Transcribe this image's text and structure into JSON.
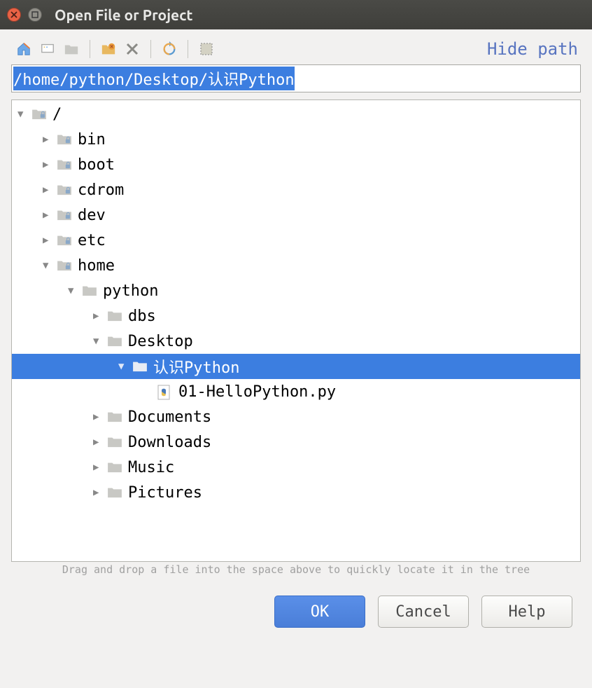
{
  "window": {
    "title": "Open File or Project"
  },
  "toolbar": {
    "hide_path": "Hide path"
  },
  "path_input": {
    "value": "/home/python/Desktop/认识Python"
  },
  "tree": [
    {
      "indent": 0,
      "expanded": true,
      "icon": "folder-lock",
      "label": "/"
    },
    {
      "indent": 1,
      "expanded": false,
      "icon": "folder-lock",
      "label": "bin"
    },
    {
      "indent": 1,
      "expanded": false,
      "icon": "folder-lock",
      "label": "boot"
    },
    {
      "indent": 1,
      "expanded": false,
      "icon": "folder-lock",
      "label": "cdrom"
    },
    {
      "indent": 1,
      "expanded": false,
      "icon": "folder-lock",
      "label": "dev"
    },
    {
      "indent": 1,
      "expanded": false,
      "icon": "folder-lock",
      "label": "etc"
    },
    {
      "indent": 1,
      "expanded": true,
      "icon": "folder-lock",
      "label": "home"
    },
    {
      "indent": 2,
      "expanded": true,
      "icon": "folder",
      "label": "python"
    },
    {
      "indent": 3,
      "expanded": false,
      "icon": "folder",
      "label": "dbs"
    },
    {
      "indent": 3,
      "expanded": true,
      "icon": "folder",
      "label": "Desktop"
    },
    {
      "indent": 4,
      "expanded": true,
      "icon": "folder",
      "label": "认识Python",
      "selected": true
    },
    {
      "indent": 5,
      "expanded": null,
      "icon": "pyfile",
      "label": "01-HelloPython.py"
    },
    {
      "indent": 3,
      "expanded": false,
      "icon": "folder",
      "label": "Documents"
    },
    {
      "indent": 3,
      "expanded": false,
      "icon": "folder",
      "label": "Downloads"
    },
    {
      "indent": 3,
      "expanded": false,
      "icon": "folder",
      "label": "Music"
    },
    {
      "indent": 3,
      "expanded": false,
      "icon": "folder",
      "label": "Pictures"
    }
  ],
  "hint": "Drag and drop a file into the space above to quickly locate it in the tree",
  "buttons": {
    "ok": "OK",
    "cancel": "Cancel",
    "help": "Help"
  }
}
